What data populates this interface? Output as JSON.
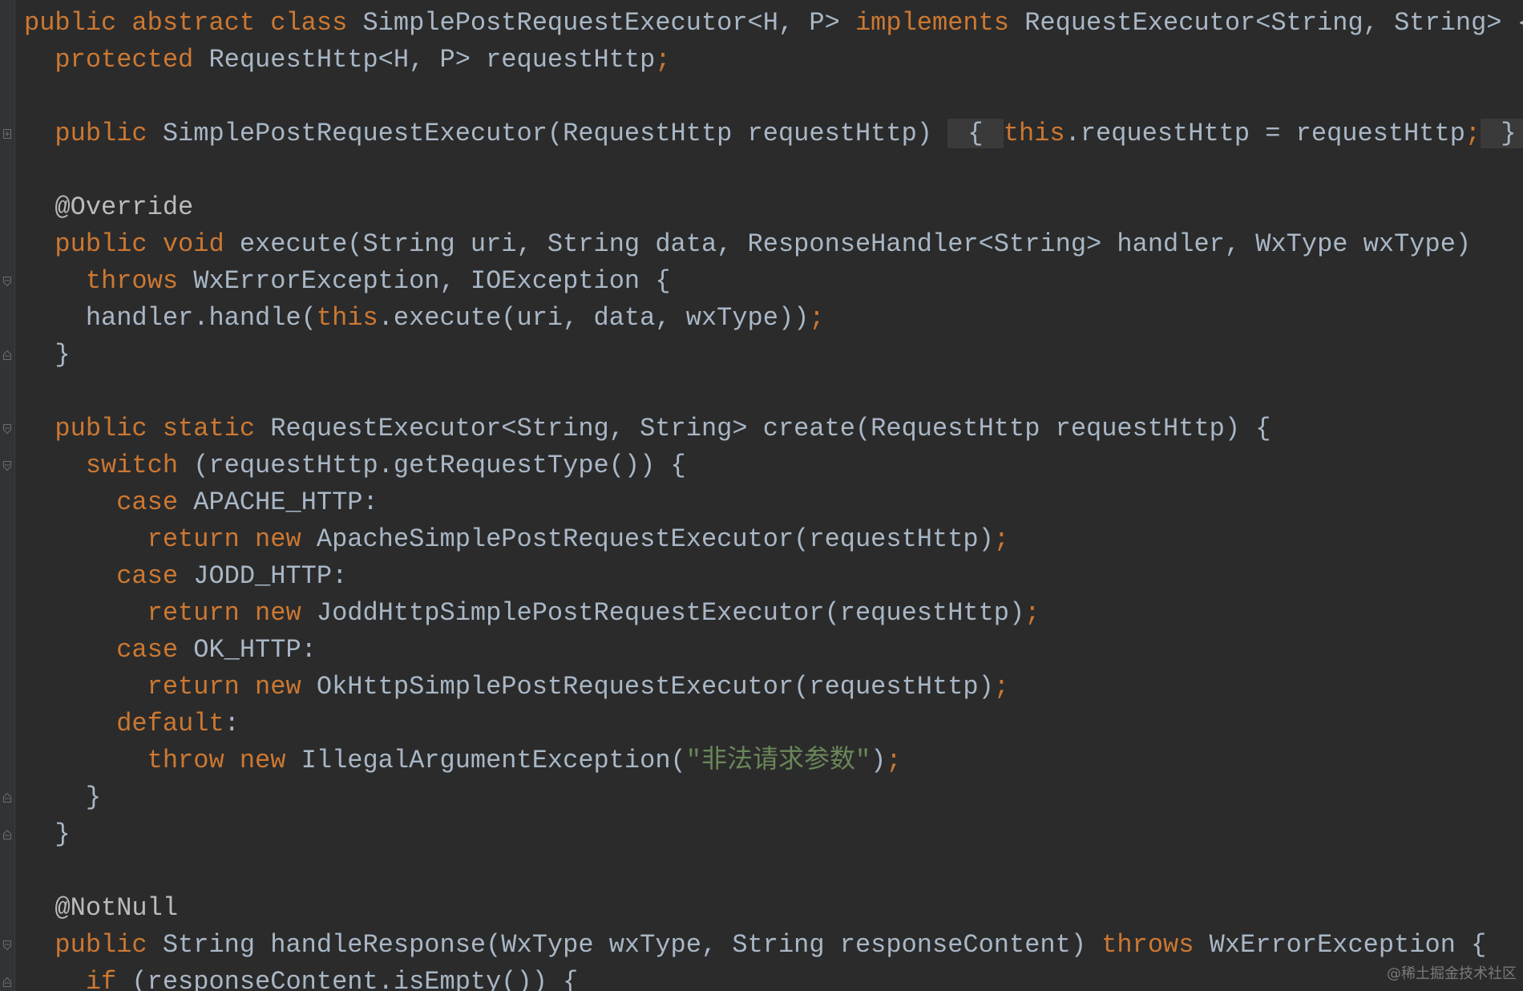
{
  "editor": {
    "lines": [
      [
        {
          "t": "public abstract class ",
          "k": "kw"
        },
        {
          "t": "SimplePostRequestExecutor<H, P> ",
          "k": ""
        },
        {
          "t": "implements ",
          "k": "kw"
        },
        {
          "t": "RequestExecutor<String, String> {",
          "k": ""
        }
      ],
      [
        {
          "t": "  protected ",
          "k": "kw"
        },
        {
          "t": "RequestHttp<H, P> requestHttp",
          "k": ""
        },
        {
          "t": ";",
          "k": "pun"
        }
      ],
      [],
      [
        {
          "t": "  public ",
          "k": "kw"
        },
        {
          "t": "SimplePostRequestExecutor(RequestHttp requestHttp) ",
          "k": ""
        },
        {
          "t": " { ",
          "k": "hl"
        },
        {
          "t": "this",
          "k": "kw"
        },
        {
          "t": ".requestHttp = requestHttp",
          "k": ""
        },
        {
          "t": ";",
          "k": "pun"
        },
        {
          "t": " } ",
          "k": "hl"
        }
      ],
      [],
      [
        {
          "t": "  @Override",
          "k": "ann"
        }
      ],
      [
        {
          "t": "  public void ",
          "k": "kw"
        },
        {
          "t": "execute(String uri, String data, ResponseHandler<String> handler, WxType wxType)",
          "k": ""
        }
      ],
      [
        {
          "t": "    throws ",
          "k": "kw"
        },
        {
          "t": "WxErrorException, IOException {",
          "k": ""
        }
      ],
      [
        {
          "t": "    handler.handle(",
          "k": ""
        },
        {
          "t": "this",
          "k": "kw"
        },
        {
          "t": ".execute(uri, data, wxType))",
          "k": ""
        },
        {
          "t": ";",
          "k": "pun"
        }
      ],
      [
        {
          "t": "  }",
          "k": ""
        }
      ],
      [],
      [
        {
          "t": "  public static ",
          "k": "kw"
        },
        {
          "t": "RequestExecutor<String, String> create(RequestHttp requestHttp) {",
          "k": ""
        }
      ],
      [
        {
          "t": "    switch ",
          "k": "kw"
        },
        {
          "t": "(requestHttp.getRequestType()) {",
          "k": ""
        }
      ],
      [
        {
          "t": "      case ",
          "k": "kw"
        },
        {
          "t": "APACHE_HTTP:",
          "k": ""
        }
      ],
      [
        {
          "t": "        return new ",
          "k": "kw"
        },
        {
          "t": "ApacheSimplePostRequestExecutor(requestHttp)",
          "k": ""
        },
        {
          "t": ";",
          "k": "pun"
        }
      ],
      [
        {
          "t": "      case ",
          "k": "kw"
        },
        {
          "t": "JODD_HTTP:",
          "k": ""
        }
      ],
      [
        {
          "t": "        return new ",
          "k": "kw"
        },
        {
          "t": "JoddHttpSimplePostRequestExecutor(requestHttp)",
          "k": ""
        },
        {
          "t": ";",
          "k": "pun"
        }
      ],
      [
        {
          "t": "      case ",
          "k": "kw"
        },
        {
          "t": "OK_HTTP:",
          "k": ""
        }
      ],
      [
        {
          "t": "        return new ",
          "k": "kw"
        },
        {
          "t": "OkHttpSimplePostRequestExecutor(requestHttp)",
          "k": ""
        },
        {
          "t": ";",
          "k": "pun"
        }
      ],
      [
        {
          "t": "      default",
          "k": "kw"
        },
        {
          "t": ":",
          "k": ""
        }
      ],
      [
        {
          "t": "        throw new ",
          "k": "kw"
        },
        {
          "t": "IllegalArgumentException(",
          "k": ""
        },
        {
          "t": "\"非法请求参数\"",
          "k": "str"
        },
        {
          "t": ")",
          "k": ""
        },
        {
          "t": ";",
          "k": "pun"
        }
      ],
      [
        {
          "t": "    }",
          "k": ""
        }
      ],
      [
        {
          "t": "  }",
          "k": ""
        }
      ],
      [],
      [
        {
          "t": "  @NotNull",
          "k": "ann"
        }
      ],
      [
        {
          "t": "  public ",
          "k": "kw"
        },
        {
          "t": "String handleResponse(WxType wxType, String responseContent) ",
          "k": ""
        },
        {
          "t": "throws ",
          "k": "kw"
        },
        {
          "t": "WxErrorException {",
          "k": ""
        }
      ],
      [
        {
          "t": "    if ",
          "k": "kw"
        },
        {
          "t": "(responseContent.isEmpty()) {",
          "k": ""
        }
      ]
    ],
    "folds": [
      {
        "line": 3,
        "icon": "fold-expand-icon"
      },
      {
        "line": 7,
        "icon": "fold-collapse-icon"
      },
      {
        "line": 9,
        "icon": "fold-end-icon"
      },
      {
        "line": 11,
        "icon": "fold-collapse-icon"
      },
      {
        "line": 12,
        "icon": "fold-collapse-icon"
      },
      {
        "line": 21,
        "icon": "fold-end-icon"
      },
      {
        "line": 22,
        "icon": "fold-end-icon"
      },
      {
        "line": 25,
        "icon": "fold-collapse-icon"
      },
      {
        "line": 26,
        "icon": "fold-end-icon"
      }
    ],
    "colors": {
      "background": "#2b2b2b",
      "keyword": "#cc7832",
      "text": "#a9b7c6",
      "string": "#6a8759",
      "annotation": "#bbbbbb"
    }
  },
  "watermark": "@稀土掘金技术社区"
}
